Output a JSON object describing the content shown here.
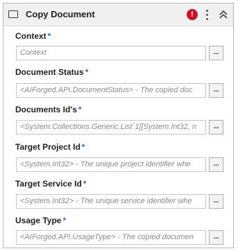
{
  "activity": {
    "title": "Copy Document"
  },
  "header": {
    "error_symbol": "!"
  },
  "fields": [
    {
      "label": "Context",
      "required_marker": "*",
      "value": "Context",
      "button_label": "..."
    },
    {
      "label": "Document Status",
      "required_marker": "*",
      "value": "<AIForged.API.DocumentStatus> - The copied doc",
      "button_label": "..."
    },
    {
      "label": "Documents Id's",
      "required_marker": "*",
      "value": "<System.Collections.Generic.List`1[[System.Int32, n",
      "button_label": "..."
    },
    {
      "label": "Target Project Id",
      "required_marker": "*",
      "value": "<System.Int32> - The unique project identifier whe",
      "button_label": "..."
    },
    {
      "label": "Target Service Id",
      "required_marker": "*",
      "value": "<System.Int32> - The unique service identifier whe",
      "button_label": "..."
    },
    {
      "label": "Usage Type",
      "required_marker": "*",
      "value": "<AIForged.API.UsageType> - The copied documen",
      "button_label": "..."
    }
  ],
  "colors": {
    "required_marker": "#2f6fb3",
    "error": "#c8102e"
  },
  "icons": {
    "activity": "window-icon",
    "error": "error-icon",
    "menu": "kebab-menu-icon",
    "collapse": "double-chevron-up-icon"
  }
}
